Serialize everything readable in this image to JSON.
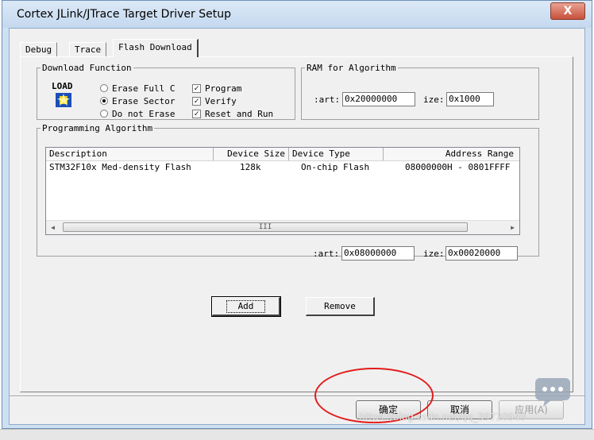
{
  "window": {
    "title": "Cortex JLink/JTrace Target Driver Setup",
    "close_label": "X"
  },
  "tabs": [
    {
      "label": "Debug"
    },
    {
      "label": "Trace"
    },
    {
      "label": "Flash Download"
    }
  ],
  "download_function": {
    "legend": "Download Function",
    "icon_text": "LOAD",
    "options": [
      {
        "label": "Erase Full C",
        "selected": false
      },
      {
        "label": "Erase Sector",
        "selected": true
      },
      {
        "label": "Do not Erase",
        "selected": false
      }
    ],
    "checks": [
      {
        "label": "Program",
        "checked": true,
        "mark": "✓"
      },
      {
        "label": "Verify",
        "checked": true,
        "mark": "✓"
      },
      {
        "label": "Reset and Run",
        "checked": true,
        "mark": "✓"
      }
    ]
  },
  "ram_for_algorithm": {
    "legend": "RAM for Algorithm",
    "start_label": ":art:",
    "start_value": "0x20000000",
    "size_label": "ize:",
    "size_value": "0x1000"
  },
  "programming_algorithm": {
    "legend": "Programming Algorithm",
    "columns": [
      "Description",
      "Device Size",
      "Device Type",
      "Address Range"
    ],
    "rows": [
      {
        "description": "STM32F10x Med-density Flash",
        "size": "128k",
        "type": "On-chip Flash",
        "range": "08000000H - 0801FFFF"
      }
    ],
    "scroll_thumb_text": "III",
    "start_label": ":art:",
    "start_value": "0x08000000",
    "size_label": "ize:",
    "size_value": "0x00020000"
  },
  "buttons": {
    "add": "Add",
    "remove": "Remove"
  },
  "dialog_buttons": {
    "ok": "确定",
    "cancel": "取消",
    "apply": "应用(A)"
  },
  "watermark": "https://blog.csdn.net/qq_39720949"
}
